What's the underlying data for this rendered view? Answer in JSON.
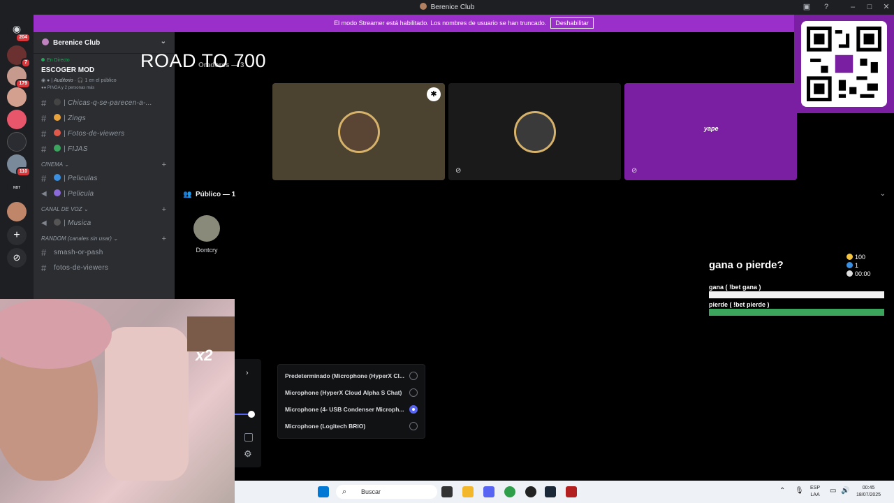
{
  "window": {
    "title": "Berenice Club"
  },
  "banner": {
    "text": "El modo Streamer está habilitado. Los nombres de usuario se han truncado.",
    "button": "Deshabilitar"
  },
  "guild_badges": [
    "204",
    "7",
    "179",
    "110",
    "NBT"
  ],
  "server": {
    "name": "Berenice Club",
    "live_label": "En Directo",
    "stage_name": "ESCOGER MOD",
    "stage_meta_channel": "Auditorio",
    "stage_meta_audience": "1 en el público",
    "stage_people": "PINGA y 2 personas más",
    "channels": [
      {
        "name": "Chicas-q-se-parecen-a-...",
        "emoji_color": "#444"
      },
      {
        "name": "Zings",
        "emoji_color": "#e8a33d"
      },
      {
        "name": "Fotos-de-viewers",
        "emoji_color": "#e05a4b"
      },
      {
        "name": "FIJAS",
        "emoji_color": "#3ba55d"
      }
    ],
    "cat_cinema": "CINEMA",
    "cinema_channels": [
      {
        "name": "Peliculas",
        "emoji_color": "#3b8fe0"
      },
      {
        "name": "Pelicula",
        "emoji_color": "#8a6ad8"
      }
    ],
    "cat_voice": "CANAL DE VOZ",
    "voice_channels": [
      {
        "name": "Musica",
        "emoji_color": "#555"
      }
    ],
    "cat_random": "RANDOM",
    "cat_random_sub": "(canales sin usar)",
    "random_channels": [
      "smash-or-pash",
      "fotos-de-viewers"
    ]
  },
  "overlay": {
    "road": "ROAD TO 700"
  },
  "stage": {
    "speakers_label": "Oradores — 3",
    "public_label": "Público — 1",
    "audience": [
      {
        "name": "Dontcry"
      }
    ]
  },
  "qr": {
    "brand": "yape"
  },
  "bet": {
    "title": "gana o pierde?",
    "coins": "100",
    "users": "1",
    "timer": "00:00",
    "option1": "gana ( !bet gana )",
    "option2": "pierde ( !bet pierde )",
    "option1_color": "#f2f2f2",
    "option2_color": "#3ba55d"
  },
  "webcam": {
    "overlay_text": "x2"
  },
  "mic_menu": {
    "options": [
      {
        "label": "Predeterminado (Microphone (HyperX Cl...",
        "selected": false
      },
      {
        "label": "Microphone (HyperX Cloud Alpha S Chat)",
        "selected": false
      },
      {
        "label": "Microphone (4- USB Condenser Microph...",
        "selected": true
      },
      {
        "label": "Microphone (Logitech BRIO)",
        "selected": false
      }
    ]
  },
  "taskbar": {
    "search_placeholder": "Buscar",
    "lang": "ESP",
    "lang2": "LAA",
    "time": "00:45",
    "date": "18/07/2025"
  }
}
